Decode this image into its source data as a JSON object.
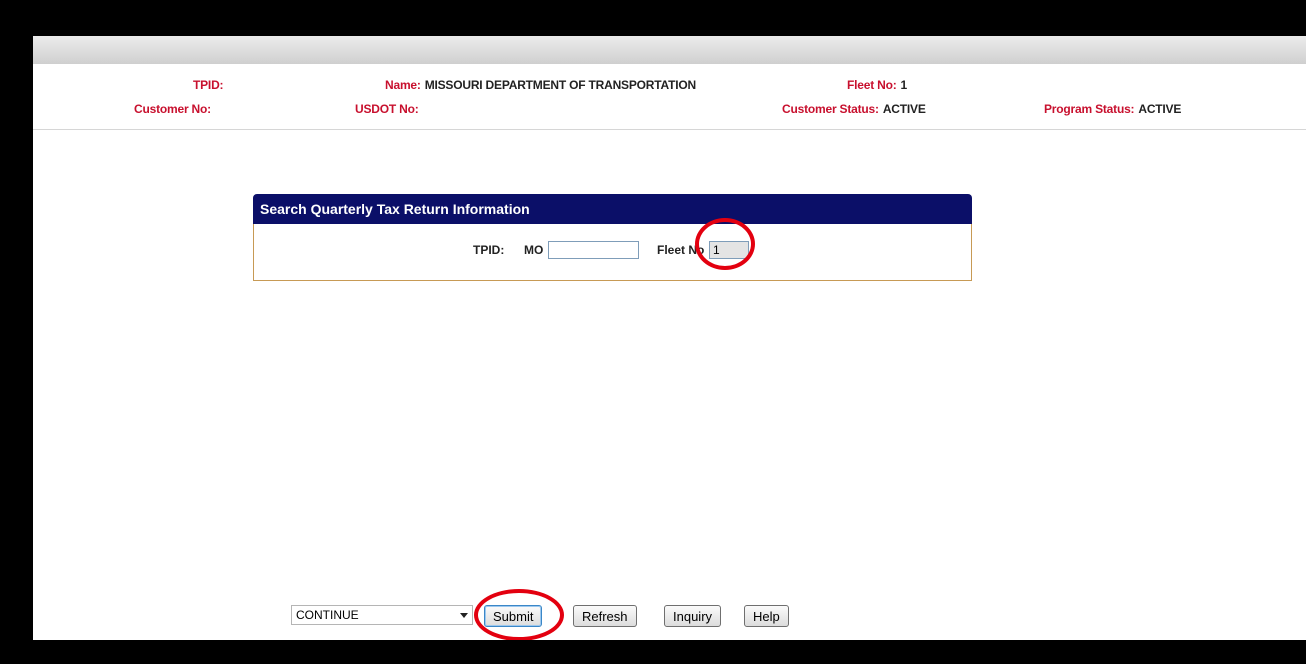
{
  "header": {
    "tpid_label": "TPID:",
    "tpid_value": "",
    "name_label": "Name:",
    "name_value": "MISSOURI DEPARTMENT OF TRANSPORTATION",
    "fleet_label": "Fleet No:",
    "fleet_value": "1",
    "customer_no_label": "Customer No:",
    "customer_no_value": "",
    "usdot_label": "USDOT No:",
    "usdot_value": "",
    "customer_status_label": "Customer Status:",
    "customer_status_value": "ACTIVE",
    "program_status_label": "Program Status:",
    "program_status_value": "ACTIVE"
  },
  "search_panel": {
    "title": "Search Quarterly Tax Return Information",
    "tpid_label": "TPID:",
    "tpid_prefix": "MO",
    "tpid_input_value": "",
    "fleet_label": "Fleet No",
    "fleet_input_value": "1"
  },
  "actions": {
    "select_value": "CONTINUE",
    "submit_label": "Submit",
    "refresh_label": "Refresh",
    "inquiry_label": "Inquiry",
    "help_label": "Help"
  },
  "colors": {
    "header_label": "#c8102e",
    "panel_header": "#0b0f68",
    "panel_border": "#c79a55",
    "annotation_ring": "#e3000f"
  }
}
